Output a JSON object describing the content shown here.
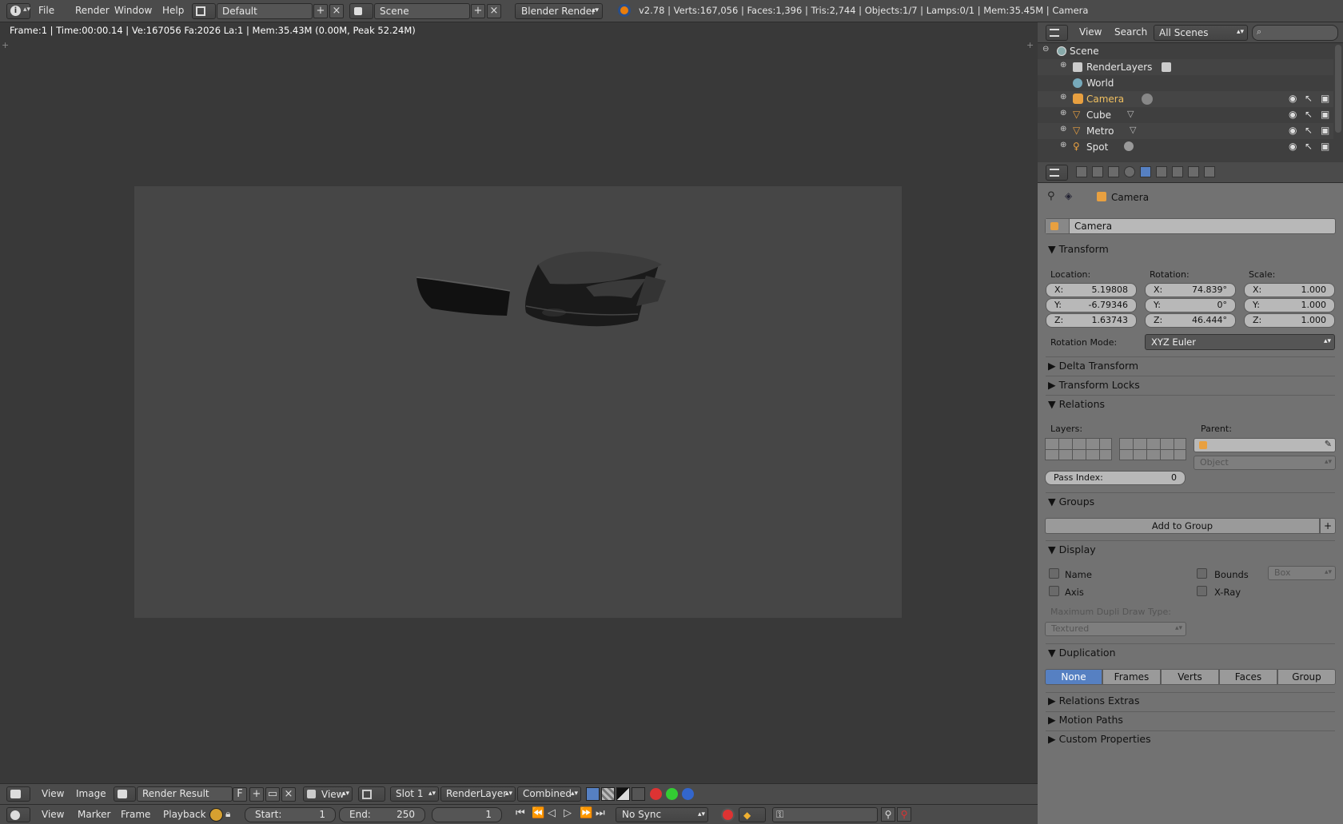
{
  "topbar": {
    "menus": [
      "File",
      "Render",
      "Window",
      "Help"
    ],
    "layout": "Default",
    "scene": "Scene",
    "engine": "Blender Render",
    "stats": "v2.78 | Verts:167,056 | Faces:1,396 | Tris:2,744 | Objects:1/7 | Lamps:0/1 | Mem:35.45M | Camera"
  },
  "viewport": {
    "info": "Frame:1 | Time:00:00.14 | Ve:167056 Fa:2026 La:1 | Mem:35.43M (0.00M, Peak 52.24M)"
  },
  "outliner": {
    "menus": [
      "View",
      "Search"
    ],
    "filter": "All Scenes",
    "items": [
      {
        "label": "Scene"
      },
      {
        "label": "RenderLayers"
      },
      {
        "label": "World"
      },
      {
        "label": "Camera"
      },
      {
        "label": "Cube"
      },
      {
        "label": "Metro"
      },
      {
        "label": "Spot"
      }
    ]
  },
  "properties": {
    "breadcrumb": "Camera",
    "object_name": "Camera",
    "transform": {
      "title": "Transform",
      "location_label": "Location:",
      "rotation_label": "Rotation:",
      "scale_label": "Scale:",
      "location": [
        {
          "axis": "X:",
          "value": "5.19808"
        },
        {
          "axis": "Y:",
          "value": "-6.79346"
        },
        {
          "axis": "Z:",
          "value": "1.63743"
        }
      ],
      "rotation": [
        {
          "axis": "X:",
          "value": "74.839°"
        },
        {
          "axis": "Y:",
          "value": "0°"
        },
        {
          "axis": "Z:",
          "value": "46.444°"
        }
      ],
      "scale": [
        {
          "axis": "X:",
          "value": "1.000"
        },
        {
          "axis": "Y:",
          "value": "1.000"
        },
        {
          "axis": "Z:",
          "value": "1.000"
        }
      ],
      "rotation_mode_label": "Rotation Mode:",
      "rotation_mode": "XYZ Euler"
    },
    "delta_transform": "Delta Transform",
    "transform_locks": "Transform Locks",
    "relations": {
      "title": "Relations",
      "layers_label": "Layers:",
      "parent_label": "Parent:",
      "parent_type": "Object",
      "pass_index_label": "Pass Index:",
      "pass_index": "0"
    },
    "groups": {
      "title": "Groups",
      "add": "Add to Group"
    },
    "display": {
      "title": "Display",
      "name": "Name",
      "axis": "Axis",
      "bounds": "Bounds",
      "bounds_type": "Box",
      "xray": "X-Ray",
      "max_dupli_label": "Maximum Dupli Draw Type:",
      "max_dupli": "Textured"
    },
    "duplication": {
      "title": "Duplication",
      "options": [
        "None",
        "Frames",
        "Verts",
        "Faces",
        "Group"
      ],
      "selected": "None"
    },
    "relations_extras": "Relations Extras",
    "motion_paths": "Motion Paths",
    "custom_properties": "Custom Properties"
  },
  "image_editor_header": {
    "menus": [
      "View",
      "Image"
    ],
    "image": "Render Result",
    "f": "F",
    "view": "View",
    "slot": "Slot 1",
    "layer": "RenderLayer",
    "pass": "Combined"
  },
  "timeline": {
    "menus": [
      "View",
      "Marker",
      "Frame",
      "Playback"
    ],
    "start_label": "Start:",
    "start": "1",
    "end_label": "End:",
    "end": "250",
    "current": "1",
    "sync": "No Sync"
  }
}
